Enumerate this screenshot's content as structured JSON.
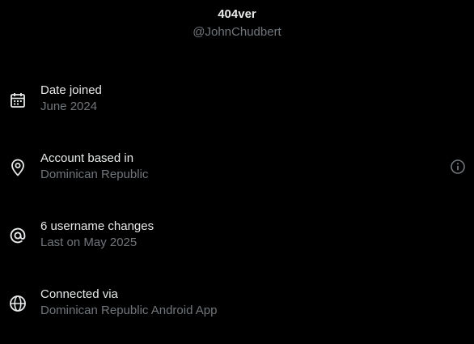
{
  "profile": {
    "display_name": "404ver",
    "handle": "@JohnChudbert"
  },
  "rows": [
    {
      "icon": "calendar-icon",
      "title": "Date joined",
      "subtitle": "June 2024"
    },
    {
      "icon": "location-pin-icon",
      "title": "Account based in",
      "subtitle": "Dominican Republic",
      "has_info": true
    },
    {
      "icon": "at-sign-icon",
      "title": "6 username changes",
      "subtitle": "Last on May 2025"
    },
    {
      "icon": "globe-icon",
      "title": "Connected via",
      "subtitle": "Dominican Republic Android App"
    }
  ],
  "colors": {
    "background": "#000000",
    "primary_text": "#e7e9ea",
    "secondary_text": "#71767b"
  }
}
